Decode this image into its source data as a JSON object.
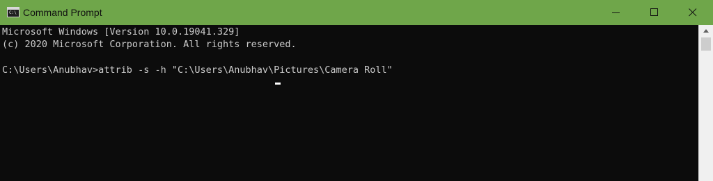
{
  "window": {
    "title": "Command Prompt",
    "titlebar_color": "#6fa64a",
    "icon_glyph": "C:\\",
    "controls": {
      "minimize": "minimize-icon",
      "maximize": "maximize-icon",
      "close": "close-icon"
    }
  },
  "console": {
    "background": "#0c0c0c",
    "text_color": "#cccccc",
    "lines": [
      "Microsoft Windows [Version 10.0.19041.329]",
      "(c) 2020 Microsoft Corporation. All rights reserved.",
      "",
      "C:\\Users\\Anubhav>attrib -s -h \"C:\\Users\\Anubhav\\Pictures\\Camera Roll\""
    ]
  },
  "scrollbar": {
    "up_icon": "triangle-up-icon"
  }
}
